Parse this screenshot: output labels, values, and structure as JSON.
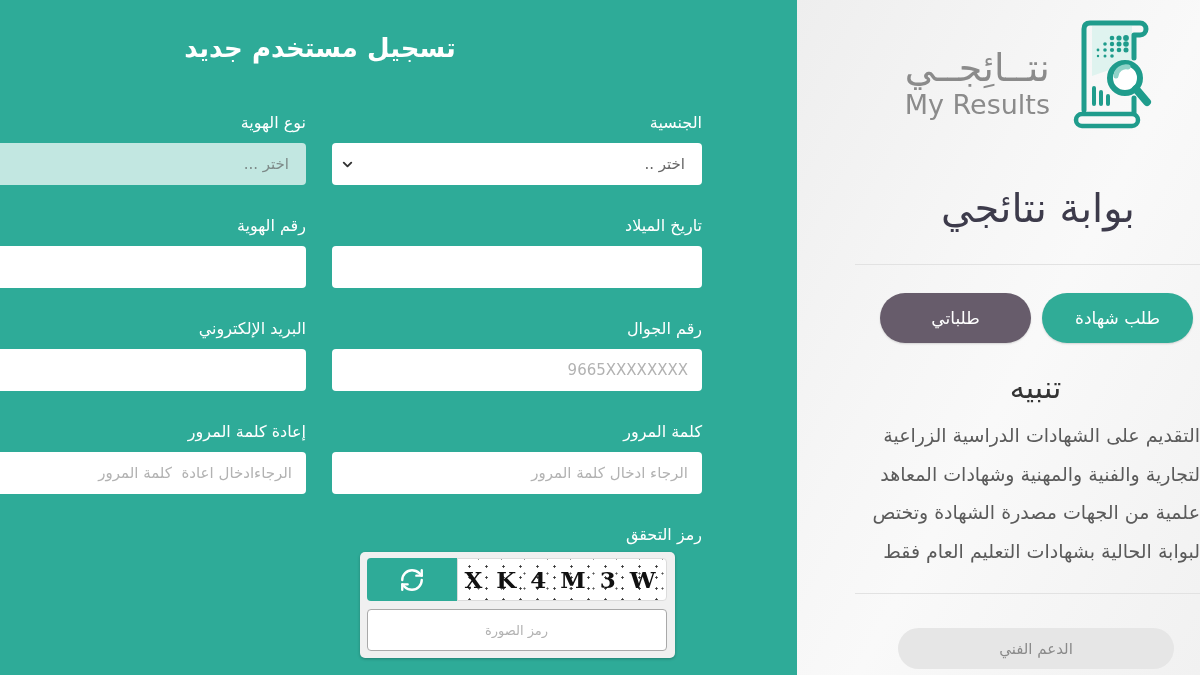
{
  "portal": {
    "logo": {
      "arabic": "نتــائِجــي",
      "english": "My Results"
    },
    "title": "بوابة نتائجي",
    "buttons": [
      {
        "label": "طلب شهادة",
        "kind": "primary"
      },
      {
        "label": "طلباتي",
        "kind": "secondary"
      }
    ],
    "notice": {
      "title": "تنبيه",
      "lines": [
        "التقديم على الشهادات الدراسية الزراعية",
        "لتجارية والفنية والمهنية وشهادات المعاهد",
        "علمية من الجهات مصدرة الشهادة وتختص",
        "لبوابة الحالية بشهادات التعليم العام فقط"
      ]
    },
    "support_button": "الدعم الفني"
  },
  "registration": {
    "title": "تسجيل مستخدم جديد",
    "fields": [
      {
        "label": "الجنسية",
        "kind": "select",
        "placeholder": "اختر ..",
        "disabled": false
      },
      {
        "label": "نوع الهوية",
        "kind": "select",
        "placeholder": "اختر ...",
        "disabled": true
      },
      {
        "label": "تاريخ الميلاد",
        "kind": "text",
        "disabled": false
      },
      {
        "label": "رقم الهوية",
        "kind": "text",
        "disabled": false
      },
      {
        "label": "رقم الجوال",
        "kind": "text",
        "placeholder": "9665XXXXXXXX",
        "disabled": false
      },
      {
        "label": "البريد الإلكتروني",
        "kind": "text",
        "disabled": false
      },
      {
        "label": "كلمة المرور",
        "kind": "password",
        "placeholder": "الرجاء ادخال كلمة المرور",
        "disabled": false
      },
      {
        "label": "إعادة كلمة المرور",
        "kind": "password",
        "placeholder": "الرجاءادخال اعادة  كلمة المرور",
        "disabled": false
      }
    ],
    "captcha": {
      "label": "رمز التحقق",
      "code": "X K 4 M 3 W",
      "placeholder": "رمز الصورة"
    }
  }
}
